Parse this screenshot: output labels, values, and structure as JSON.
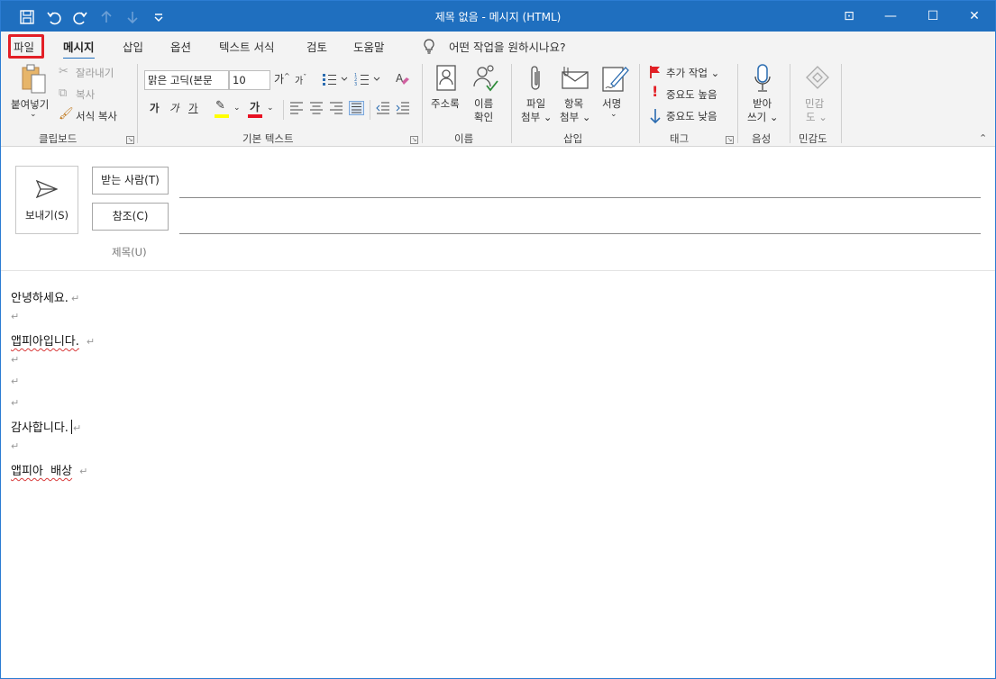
{
  "window": {
    "title": "제목 없음  -  메시지 (HTML)"
  },
  "quick_access": {
    "save_icon": "save-icon",
    "undo_icon": "undo-icon",
    "redo_icon": "redo-icon",
    "up_icon": "arrow-up-icon",
    "down_icon": "arrow-down-icon",
    "customize_icon": "customize-qat-icon"
  },
  "window_controls": {
    "ribbon_display": "⊡",
    "minimize": "—",
    "maximize": "☐",
    "close": "✕"
  },
  "tabs": [
    "파일",
    "메시지",
    "삽입",
    "옵션",
    "텍스트 서식",
    "검토",
    "도움말"
  ],
  "active_tab": "메시지",
  "highlighted_tab": "파일",
  "tell_me": "어떤 작업을 원하시나요?",
  "ribbon": {
    "clipboard": {
      "label": "클립보드",
      "paste": "붙여넣기",
      "cut": "잘라내기",
      "copy": "복사",
      "format_painter": "서식 복사"
    },
    "basic_text": {
      "label": "기본 텍스트",
      "font": "맑은 고딕(본문",
      "size": "10",
      "grow": "가",
      "shrink": "가",
      "bold": "가",
      "italic": "가",
      "underline": "가",
      "font_color_label": "가",
      "highlight_color": "#ffff00",
      "font_color": "#e81123"
    },
    "names": {
      "label": "이름",
      "address_book": "주소록",
      "check_names_1": "이름",
      "check_names_2": "확인"
    },
    "insert": {
      "label": "삽입",
      "attach_file_1": "파일",
      "attach_file_2": "첨부",
      "attach_item_1": "항목",
      "attach_item_2": "첨부",
      "signature": "서명"
    },
    "tags": {
      "label": "태그",
      "follow_up": "추가 작업",
      "high_importance": "중요도 높음",
      "low_importance": "중요도 낮음"
    },
    "voice": {
      "label": "음성",
      "dictate_1": "받아",
      "dictate_2": "쓰기"
    },
    "sensitivity": {
      "label": "민감도",
      "sensitivity_1": "민감",
      "sensitivity_2": "도"
    }
  },
  "compose": {
    "send": "보내기(S)",
    "to": "받는 사람(T)",
    "cc": "참조(C)",
    "subject": "제목(U)"
  },
  "body": {
    "lines": [
      "안녕하세요.",
      "",
      "앱피아입니다.",
      "",
      "",
      "",
      "감사합니다.",
      "",
      "앱피아  배상"
    ]
  }
}
